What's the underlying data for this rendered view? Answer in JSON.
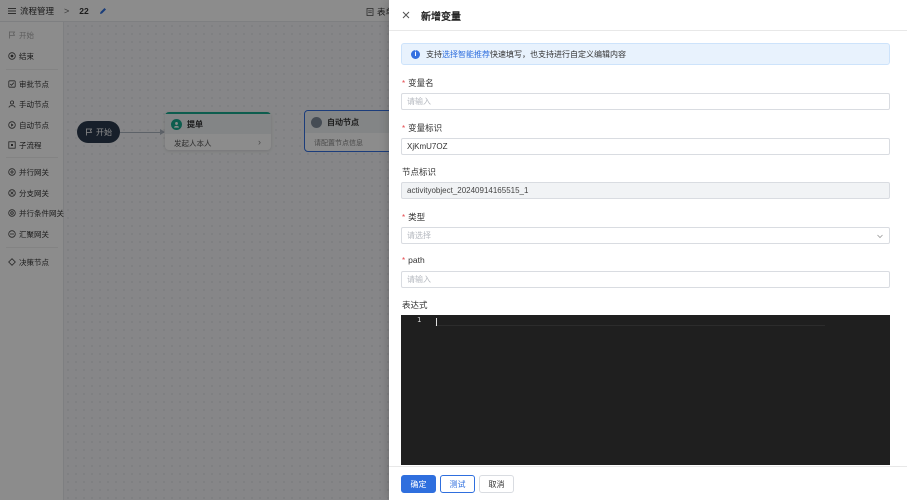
{
  "topbar": {
    "breadcrumb_label": "流程管理",
    "breadcrumb_sep": ">",
    "process_number": "22",
    "right_tab_label": "表单"
  },
  "sidebar": {
    "items": [
      {
        "label": "开始",
        "icon": "flag-icon",
        "disabled": true
      },
      {
        "label": "结束",
        "icon": "stop-circle-icon",
        "disabled": false
      },
      {
        "label": "审批节点",
        "icon": "approve-icon",
        "disabled": false
      },
      {
        "label": "手动节点",
        "icon": "hand-icon",
        "disabled": false
      },
      {
        "label": "自动节点",
        "icon": "auto-icon",
        "disabled": false
      },
      {
        "label": "子流程",
        "icon": "subprocess-icon",
        "disabled": false
      },
      {
        "label": "并行网关",
        "icon": "parallel-gateway-icon",
        "disabled": false
      },
      {
        "label": "分支网关",
        "icon": "branch-gateway-icon",
        "disabled": false
      },
      {
        "label": "并行条件网关",
        "icon": "condition-gateway-icon",
        "disabled": false
      },
      {
        "label": "汇聚网关",
        "icon": "merge-gateway-icon",
        "disabled": false
      },
      {
        "label": "决策节点",
        "icon": "decision-icon",
        "disabled": false
      }
    ]
  },
  "canvas": {
    "start_node_label": "开始",
    "task_node_title": "提单",
    "task_node_sub": "发起人本人",
    "auto_node_title": "自动节点",
    "auto_node_sub": "请配置节点信息"
  },
  "drawer": {
    "title": "新增变量",
    "notice": {
      "prefix": "支持",
      "link": "选择智能推荐",
      "suffix": "快速填写，也支持进行自定义编辑内容"
    },
    "fields": {
      "var_name": {
        "label": "变量名",
        "value": "",
        "placeholder": "请输入"
      },
      "var_id": {
        "label": "变量标识",
        "value": "XjKmU7OZ",
        "placeholder": "请输入"
      },
      "node_id": {
        "label": "节点标识",
        "value": "activityobject_20240914165515_1"
      },
      "type": {
        "label": "类型",
        "placeholder": "请选择"
      },
      "path": {
        "label": "path",
        "value": "",
        "placeholder": "请输入"
      },
      "expression": {
        "label": "表达式",
        "line_number": "1"
      }
    },
    "buttons": {
      "confirm": "确定",
      "test": "测试",
      "cancel": "取消"
    }
  },
  "colors": {
    "primary": "#2f6fde",
    "required": "#e5484d",
    "task_accent": "#19a98f",
    "editor_bg": "#1f1f1f"
  }
}
